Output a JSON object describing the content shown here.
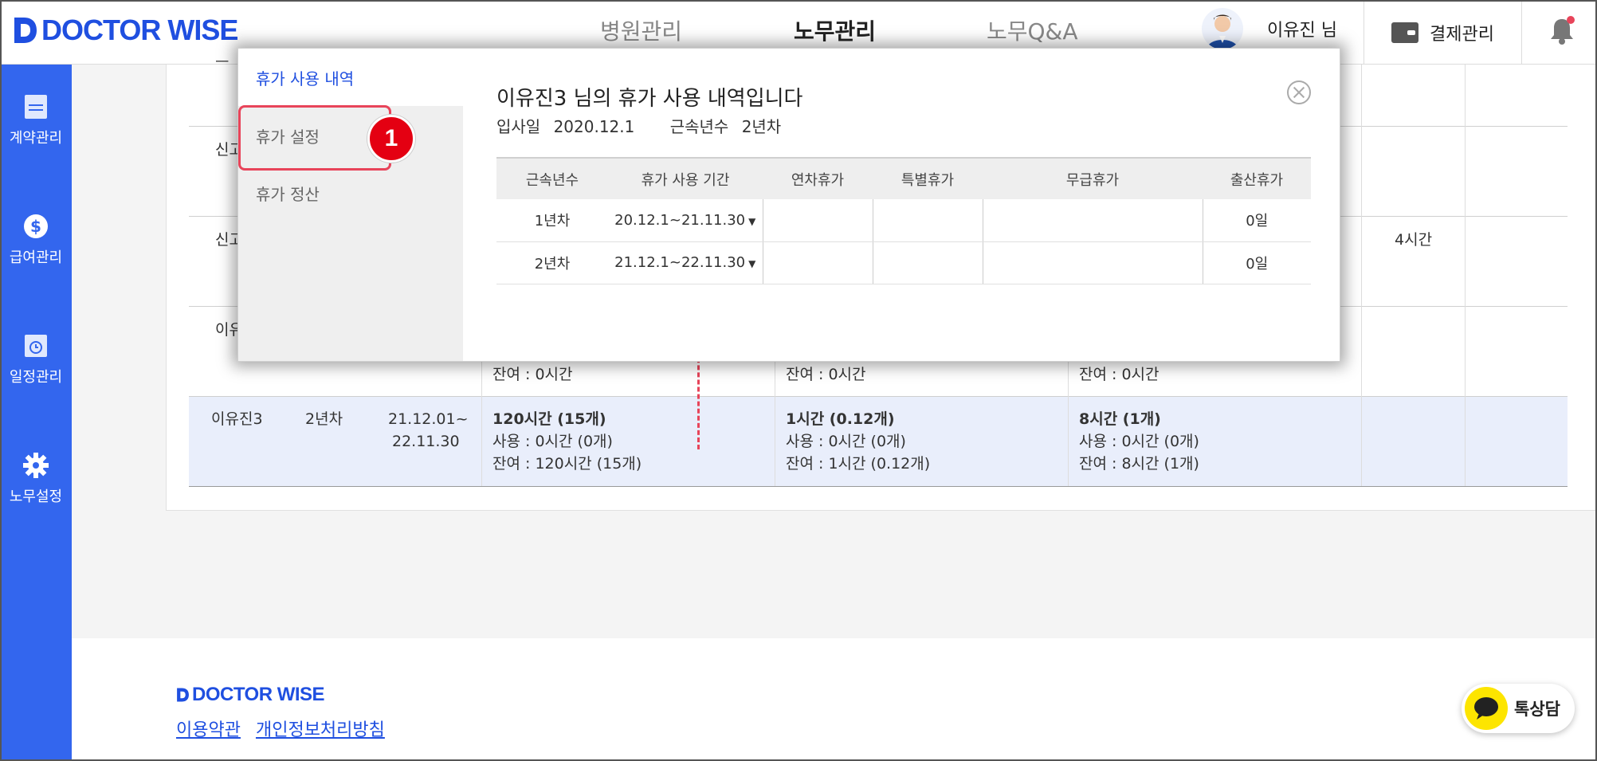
{
  "header": {
    "logo": "DOCTOR WISE",
    "nav": [
      "병원관리",
      "노무관리",
      "노무Q&A"
    ],
    "user": "이유진 님",
    "payment": "결제관리"
  },
  "sidebar": {
    "items": [
      "계약관리",
      "급여관리",
      "일정관리",
      "노무설정"
    ]
  },
  "background_table": {
    "partial_names": [
      "신고",
      "신고",
      "이유"
    ],
    "partial_first_char": "ㅡ",
    "row2_hours": "4시간",
    "row3_remaining": [
      "잔여 : 0시간",
      "잔여 : 0시간",
      "잔여 : 0시간"
    ],
    "highlight_row": {
      "name": "이유진3",
      "year": "2년차",
      "period_start": "21.12.01~",
      "period_end": "22.11.30",
      "c1": [
        "120시간 (15개)",
        "사용 : 0시간 (0개)",
        "잔여 : 120시간 (15개)"
      ],
      "c2": [
        "1시간 (0.12개)",
        "사용 : 0시간 (0개)",
        "잔여 : 1시간 (0.12개)"
      ],
      "c3": [
        "8시간 (1개)",
        "사용 : 0시간 (0개)",
        "잔여 : 8시간 (1개)"
      ]
    }
  },
  "modal": {
    "tabs": [
      "휴가 사용 내역",
      "휴가 설정",
      "휴가 정산"
    ],
    "badge": "1",
    "title": "이유진3 님의 휴가 사용 내역입니다",
    "hire_label": "입사일",
    "hire_date": "2020.12.1",
    "tenure_label": "근속년수",
    "tenure_value": "2년차",
    "columns": [
      "근속년수",
      "휴가 사용 기간",
      "연차휴가",
      "특별휴가",
      "무급휴가",
      "출산휴가"
    ],
    "rows": [
      {
        "year": "1년차",
        "period": "20.12.1~21.11.30",
        "annual": "",
        "special": "",
        "unpaid": "",
        "maternity": "0일"
      },
      {
        "year": "2년차",
        "period": "21.12.1~22.11.30",
        "annual": "",
        "special": "",
        "unpaid": "",
        "maternity": "0일"
      }
    ]
  },
  "footer": {
    "logo": "DOCTOR WISE",
    "links": [
      "이용약관",
      "개인정보처리방침"
    ],
    "talk": "톡상담"
  },
  "colors": {
    "brand": "#1f4fe0",
    "sidebar": "#3366ee",
    "highlight": "#e8445a",
    "badge": "#e40012"
  }
}
